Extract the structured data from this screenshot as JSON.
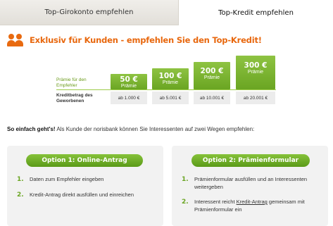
{
  "tabs": [
    {
      "label": "Top-Girokonto empfehlen",
      "active": false
    },
    {
      "label": "Top-Kredit empfehlen",
      "active": true
    }
  ],
  "headline": "Exklusiv für Kunden - empfehlen Sie den Top-Kredit!",
  "bonus_table": {
    "praemie_label": "Prämie für den Empfehler",
    "kredit_label": "Kreditbetrag des Geworbenen",
    "tiers": [
      {
        "amount": "50 €",
        "sub": "Prämie",
        "threshold": "ab 1.000 €"
      },
      {
        "amount": "100 €",
        "sub": "Prämie",
        "threshold": "ab 5.001 €"
      },
      {
        "amount": "200 €",
        "sub": "Prämie",
        "threshold": "ab 10.001 €"
      },
      {
        "amount": "300 €",
        "sub": "Prämie",
        "threshold": "ab 20.001 €"
      }
    ]
  },
  "intro": {
    "bold": "So einfach geht's!",
    "text": " Als Kunde der norisbank können Sie Interessenten auf zwei Wegen empfehlen:"
  },
  "options": [
    {
      "title": "Option 1: Online-Antrag",
      "steps": [
        {
          "num": "1.",
          "text": "Daten zum Empfehler eingeben"
        },
        {
          "num": "2.",
          "text": "Kredit-Antrag direkt ausfüllen und einreichen"
        }
      ]
    },
    {
      "title": "Option 2: Prämienformular",
      "steps": [
        {
          "num": "1.",
          "text": "Prämienformular ausfüllen und an Interessenten weitergeben"
        },
        {
          "num": "2.",
          "text_before": "Interessent reicht ",
          "link": "Kredit-Antrag",
          "text_after": " gemeinsam mit Prämienformular ein"
        }
      ]
    }
  ],
  "colors": {
    "accent_orange": "#e8670d",
    "accent_green": "#6aa522"
  }
}
